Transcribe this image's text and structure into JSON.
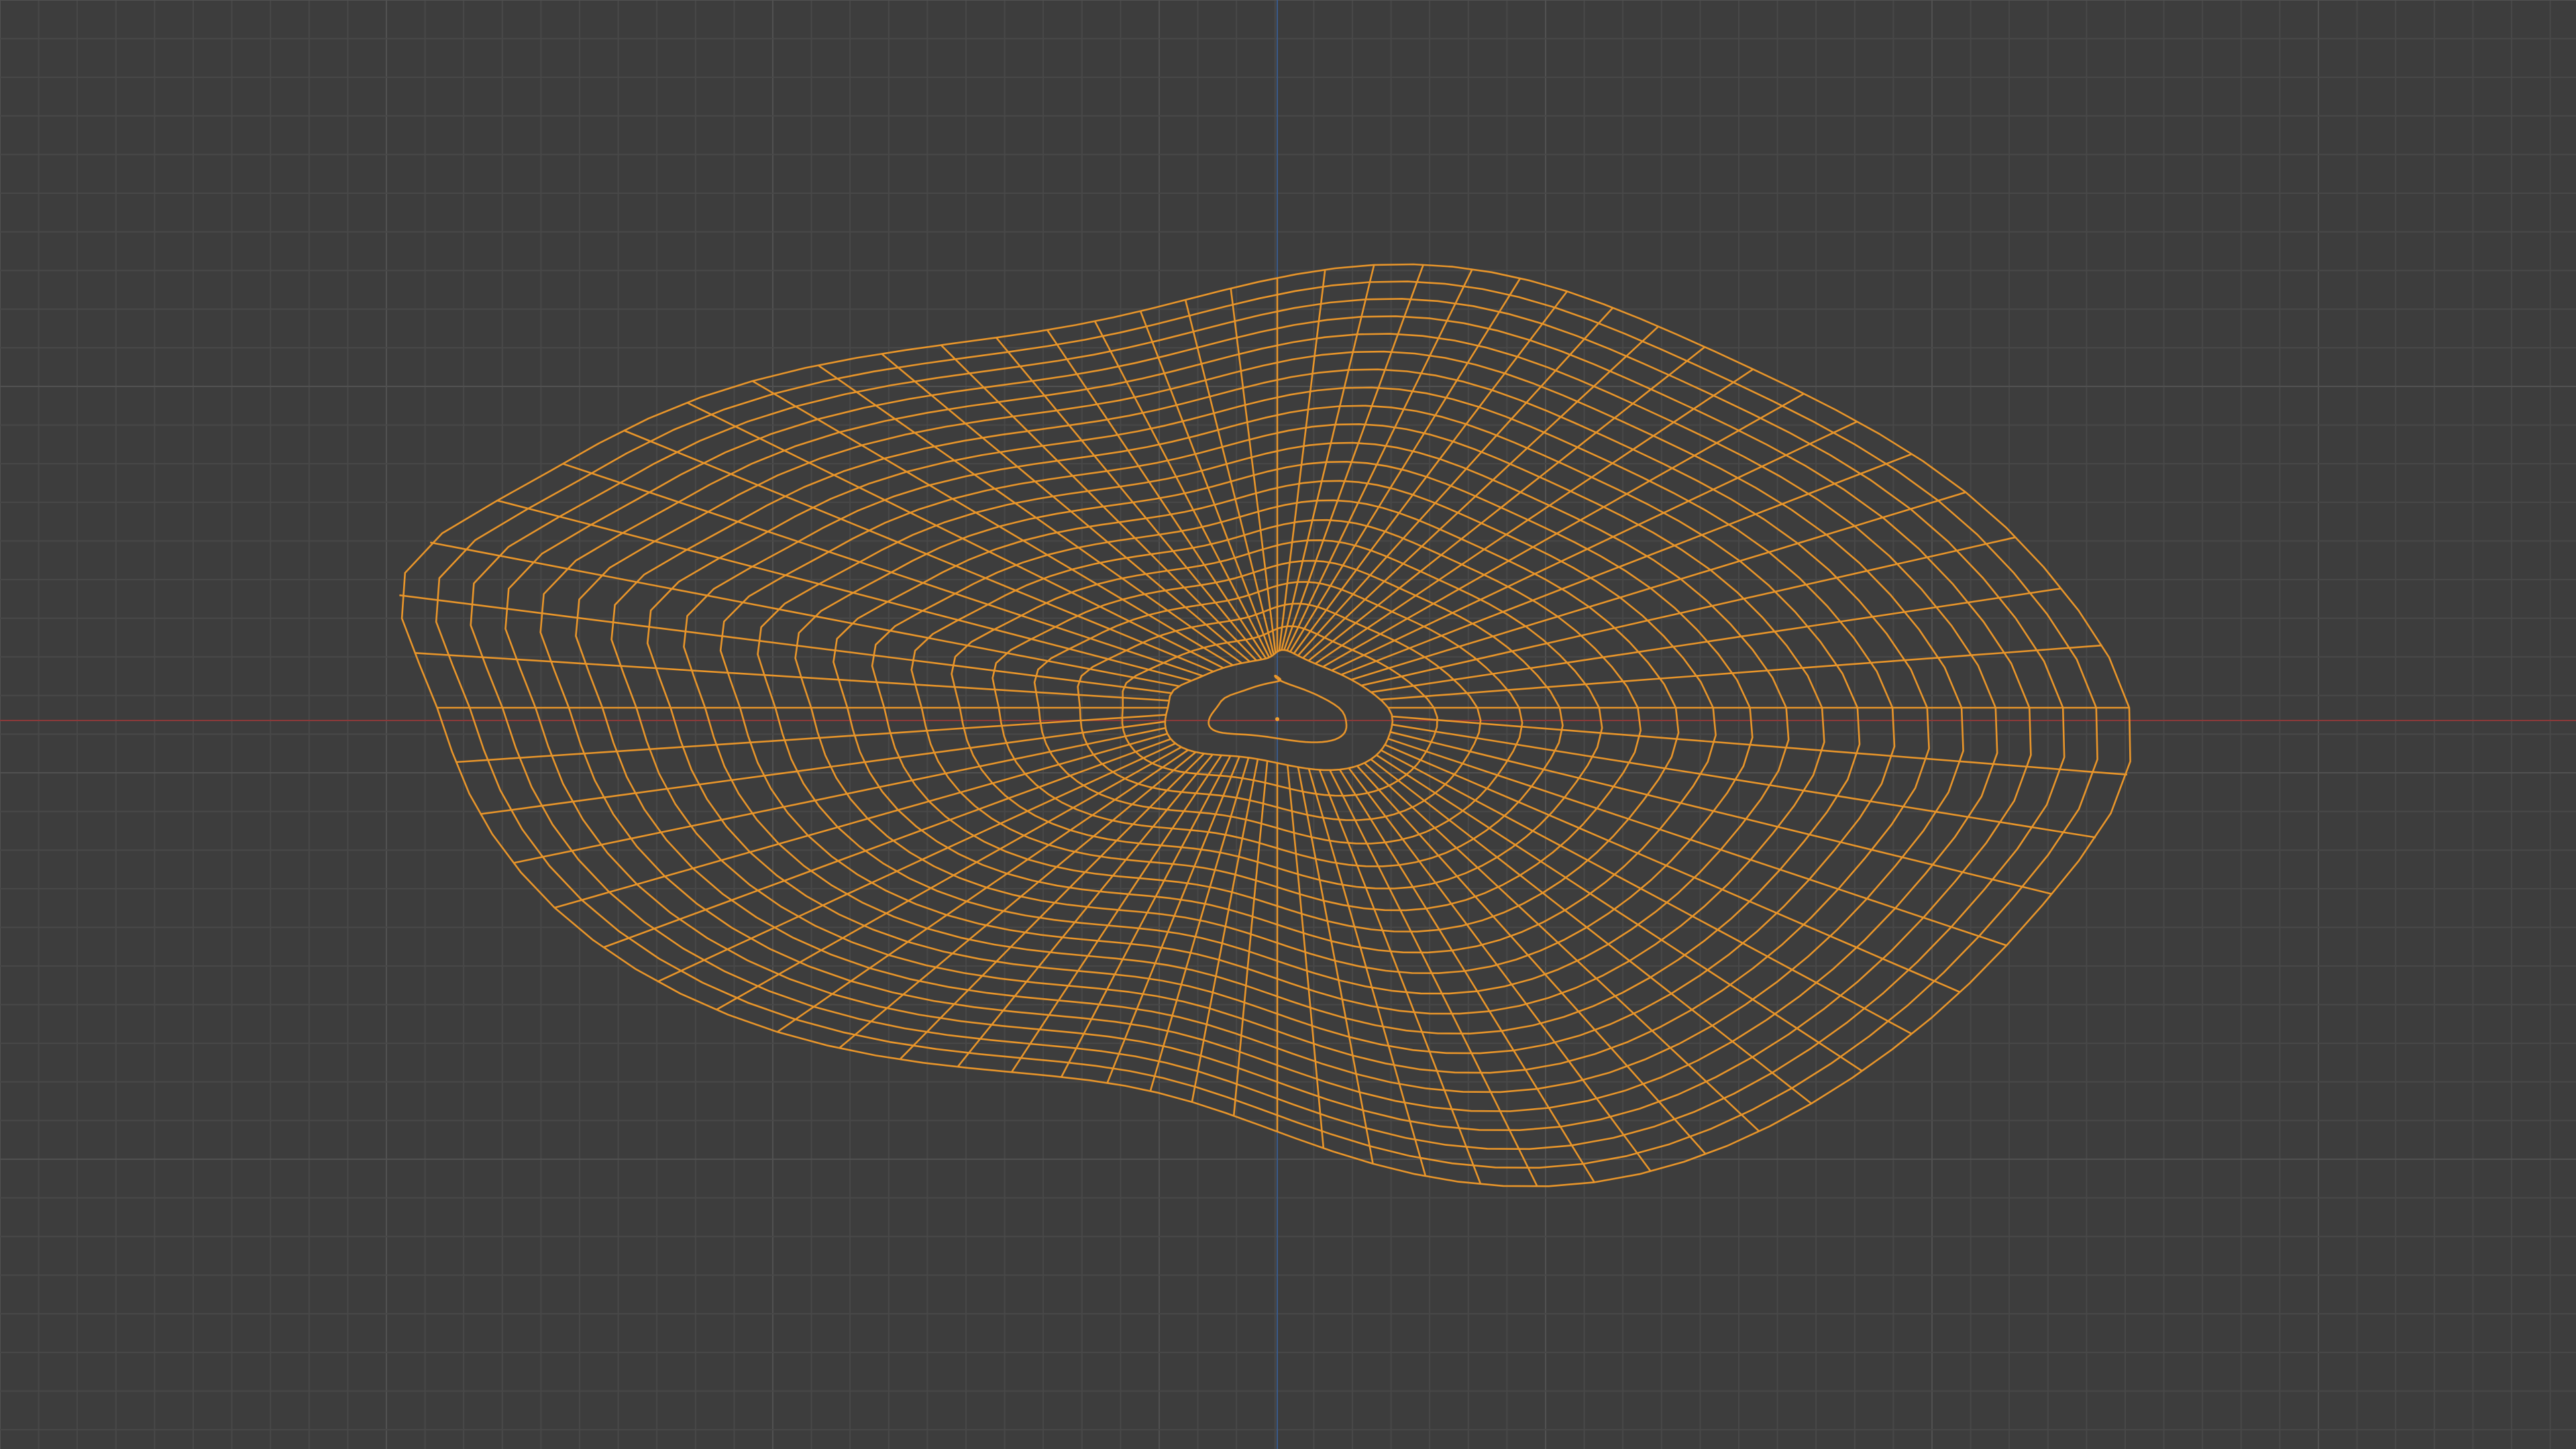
{
  "viewport": {
    "background_color": "#3d3d3d",
    "grid_minor_color": "#484848",
    "grid_major_color": "#515151",
    "x_axis_color": "#8a3a3a",
    "y_axis_color": "#3a5a8a",
    "wire_color": "#e8952a",
    "origin_color": "#f0a030",
    "mode": "wireframe",
    "object_state": "selected"
  }
}
